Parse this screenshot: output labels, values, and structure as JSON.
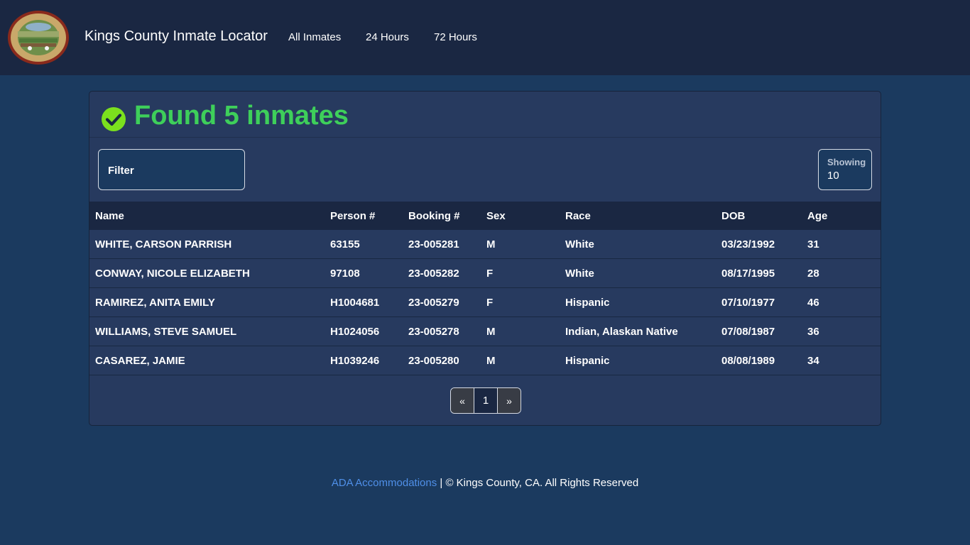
{
  "navbar": {
    "brand": "Kings County Inmate Locator",
    "links": [
      "All Inmates",
      "24 Hours",
      "72 Hours"
    ],
    "logo_icon": "county-seal-logo"
  },
  "results": {
    "title": "Found 5 inmates",
    "status_icon": "check-circle-icon",
    "status_color": "#3ecf5a"
  },
  "filter": {
    "label": "Filter"
  },
  "showing": {
    "label": "Showing",
    "value": "10"
  },
  "table": {
    "columns": [
      "Name",
      "Person #",
      "Booking #",
      "Sex",
      "Race",
      "DOB",
      "Age"
    ],
    "rows": [
      [
        "WHITE, CARSON PARRISH",
        "63155",
        "23-005281",
        "M",
        "White",
        "03/23/1992",
        "31"
      ],
      [
        "CONWAY, NICOLE ELIZABETH",
        "97108",
        "23-005282",
        "F",
        "White",
        "08/17/1995",
        "28"
      ],
      [
        "RAMIREZ, ANITA EMILY",
        "H1004681",
        "23-005279",
        "F",
        "Hispanic",
        "07/10/1977",
        "46"
      ],
      [
        "WILLIAMS, STEVE SAMUEL",
        "H1024056",
        "23-005278",
        "M",
        "Indian, Alaskan Native",
        "07/08/1987",
        "36"
      ],
      [
        "CASAREZ, JAMIE",
        "H1039246",
        "23-005280",
        "M",
        "Hispanic",
        "08/08/1989",
        "34"
      ]
    ]
  },
  "pagination": {
    "prev": "«",
    "current": "1",
    "next": "»"
  },
  "footer": {
    "link": "ADA Accommodations",
    "text": " | © Kings County, CA. All Rights Reserved",
    "link_color": "#4f8fe8"
  }
}
